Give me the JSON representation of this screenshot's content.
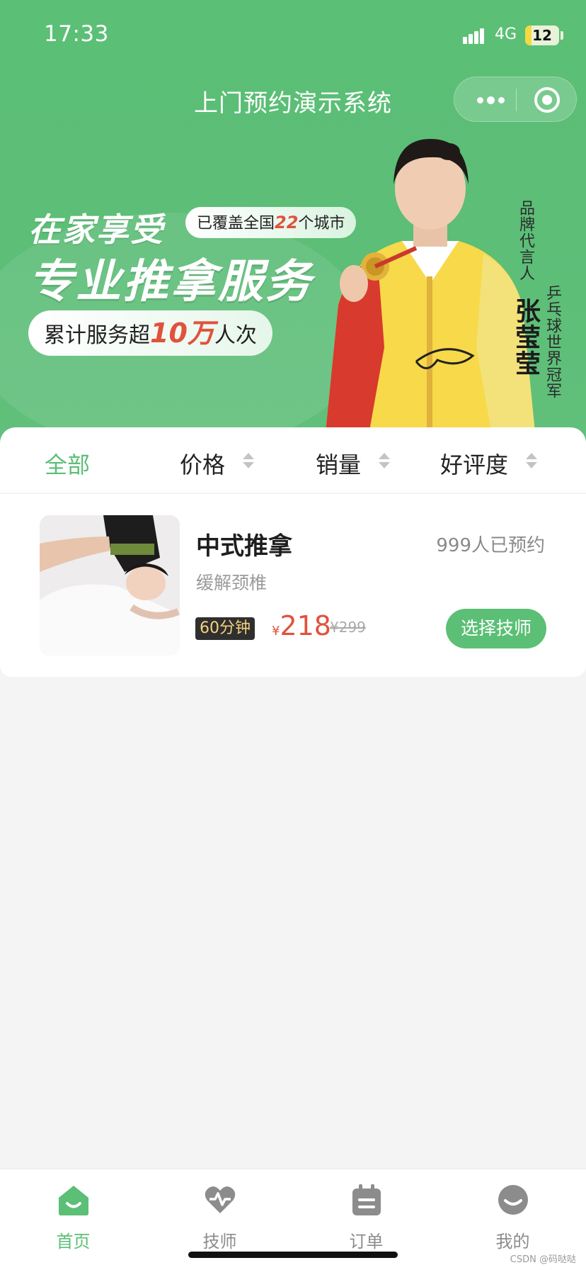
{
  "status_bar": {
    "time": "17:33",
    "network": "4G",
    "battery": "12"
  },
  "nav": {
    "title": "上门预约演示系统"
  },
  "banner": {
    "headline1": "在家享受",
    "coverage_prefix": "已覆盖全国",
    "coverage_num": "22",
    "coverage_suffix": "个城市",
    "headline2": "专业推拿服务",
    "served_prefix": "累计服务超",
    "served_num": "10万",
    "served_suffix": "人次",
    "brand_label": "品牌代言人",
    "spokesperson": "张莹莹",
    "champion_label": "乒乓球世界冠军"
  },
  "filters": [
    {
      "label": "全部",
      "active": true
    },
    {
      "label": "价格",
      "active": false
    },
    {
      "label": "销量",
      "active": false
    },
    {
      "label": "好评度",
      "active": false
    }
  ],
  "service": {
    "title": "中式推拿",
    "booked": "999人已预约",
    "desc": "缓解颈椎",
    "duration": "60分钟",
    "currency": "¥",
    "price": "218",
    "old_price": "¥299",
    "select_label": "选择技师"
  },
  "tabbar": [
    {
      "label": "首页",
      "icon": "home-icon",
      "active": true
    },
    {
      "label": "技师",
      "icon": "heart-pulse-icon",
      "active": false
    },
    {
      "label": "订单",
      "icon": "calendar-icon",
      "active": false
    },
    {
      "label": "我的",
      "icon": "user-icon",
      "active": false
    }
  ],
  "watermark": "CSDN @码哒哒",
  "colors": {
    "brand_green": "#5bbf76",
    "price_red": "#e0523c"
  }
}
